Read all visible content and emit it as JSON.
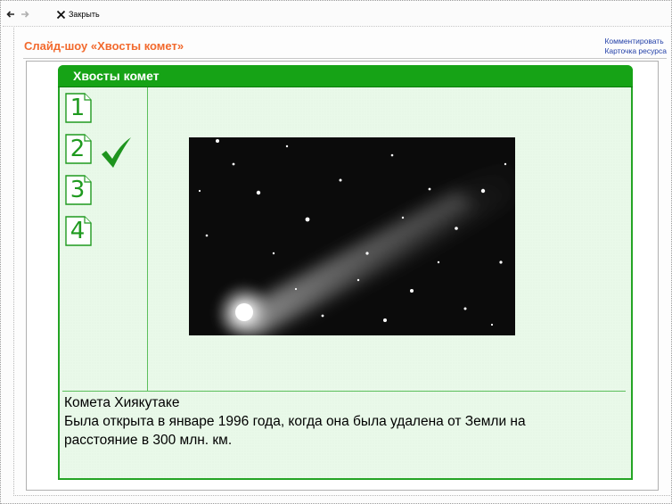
{
  "toolbar": {
    "back_icon": "back-arrow-icon",
    "forward_icon": "forward-arrow-icon",
    "close_icon": "close-x-icon",
    "close_label": "Закрыть"
  },
  "page": {
    "title": "Слайд-шоу «Хвосты комет»",
    "title_color": "#f26a2e",
    "links": [
      "Комментировать",
      "Карточка ресурса"
    ],
    "link_color": "#2340a8"
  },
  "slideshow": {
    "title": "Хвосты комет",
    "accent_color": "#16a316",
    "background_color": "#e9f9e9",
    "thumbnails": [
      {
        "label": "1",
        "selected": false
      },
      {
        "label": "2",
        "selected": true
      },
      {
        "label": "3",
        "selected": false
      },
      {
        "label": "4",
        "selected": false
      }
    ],
    "selected_indicator_icon": "check-icon",
    "image_icon": "comet-photo",
    "caption_title": "Комета Хиякутаке",
    "caption_line1": "Была открыта в январе 1996 года, когда она была удалена от Земли на",
    "caption_line2": "расстояние в 300 млн. км."
  }
}
